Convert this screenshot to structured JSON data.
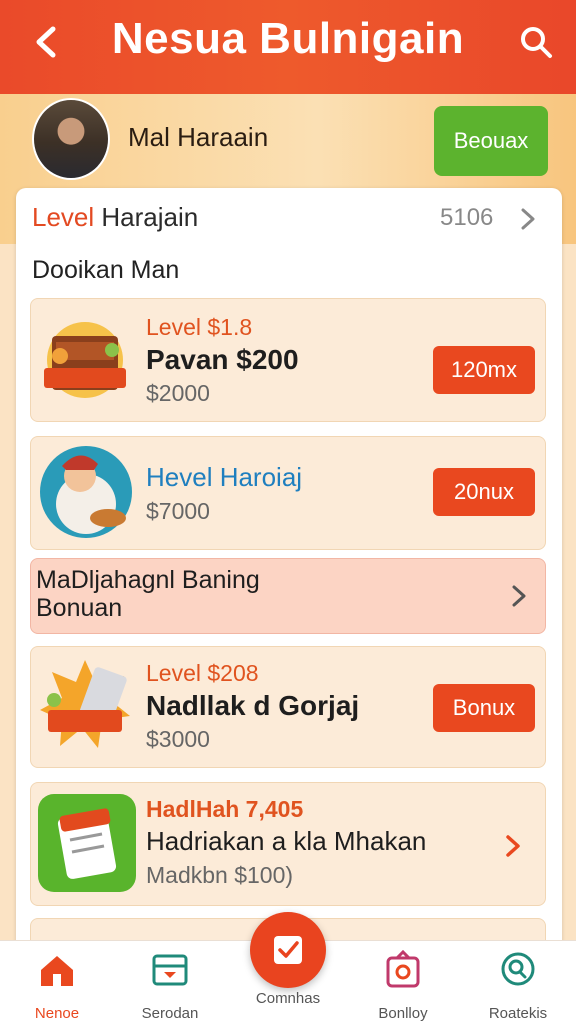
{
  "header": {
    "title": "Nesua Bulnigain",
    "back_icon": "chevron-left-icon",
    "search_icon": "search-icon"
  },
  "user": {
    "name": "Mal Haraain",
    "action_label": "Beouax"
  },
  "level": {
    "label_prefix": "Level",
    "label_rest": " Harajain",
    "count": "5106"
  },
  "section_title": "Dooikan Man",
  "items": [
    {
      "line1": "Level $1.8",
      "line2": "Pavan $200",
      "line3": "$2000",
      "button": "120mx"
    },
    {
      "line1": "Hevel Haroiaj",
      "line2": "",
      "line3": "$7000",
      "button": "20nux"
    },
    {
      "line1": "Level $208",
      "line2": "Nadllak d Gorjaj",
      "line3": "$3000",
      "button": "Bonux"
    },
    {
      "line1": "HadlHah 7,405",
      "line2": "Hadriakan a kla Mhakan",
      "line3": "Madkbn $100)",
      "button": ""
    }
  ],
  "banner": {
    "text": "MaDljahagnl Baning Bonuan"
  },
  "nav": [
    {
      "label": "Nenoe"
    },
    {
      "label": "Serodan"
    },
    {
      "label": "Comnhas"
    },
    {
      "label": "Bonlloy"
    },
    {
      "label": "Roatekis"
    }
  ],
  "colors": {
    "primary": "#e9481f",
    "green": "#5cb32e",
    "cream": "#fcebd8"
  }
}
